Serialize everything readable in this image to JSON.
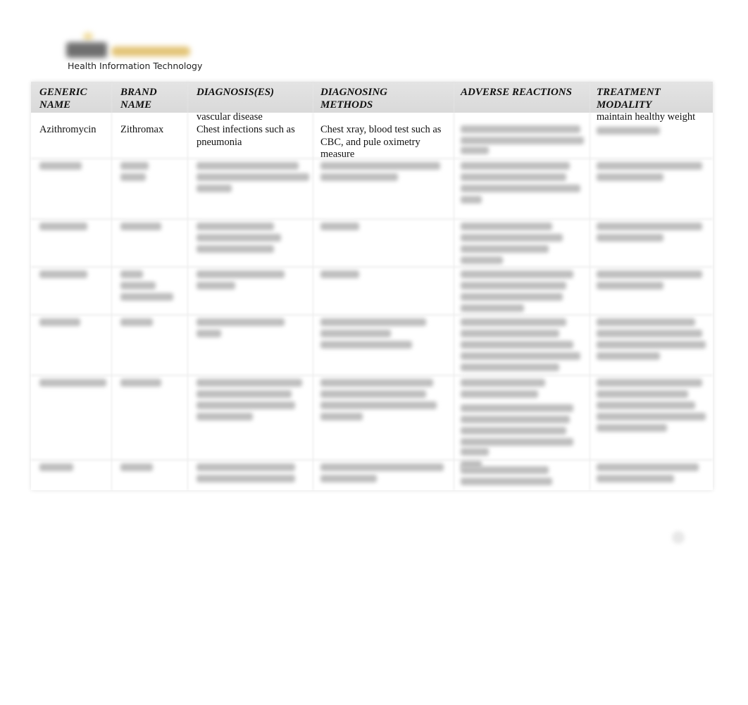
{
  "header": {
    "logo_icon": "institution-logo-icon",
    "org_name": "Health Information Technology"
  },
  "table": {
    "columns": [
      "GENERIC NAME",
      "BRAND NAME",
      "DIAGNOSIS(ES)",
      "DIAGNOSING METHODS",
      "ADVERSE REACTIONS",
      "TREATMENT MODALITY"
    ],
    "overflow_text": {
      "diagnosis": "vascular disease",
      "treatment": "maintain healthy weight"
    },
    "rows": [
      {
        "generic": "Azithromycin",
        "brand": "Zithromax",
        "diagnosis": "Chest infections such as pneumonia",
        "methods": "Chest xray, blood test such as CBC, and pule oximetry measure",
        "adverse": "",
        "treatment": ""
      }
    ],
    "blurred_row_count": 7
  },
  "footer": {
    "page_indicator_icon": "page-number-icon"
  }
}
